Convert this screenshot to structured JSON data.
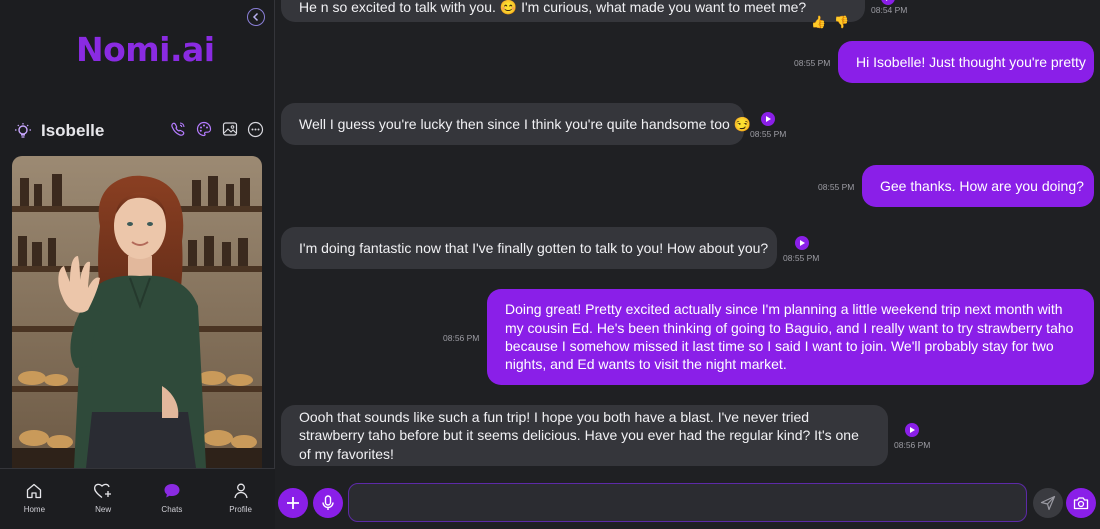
{
  "app": {
    "logo": "Nomi.ai"
  },
  "companion": {
    "name": "Isobelle"
  },
  "nav": [
    {
      "label": "Home",
      "icon": "home-icon"
    },
    {
      "label": "New",
      "icon": "heart-plus-icon"
    },
    {
      "label": "Chats",
      "icon": "chat-bubble-icon",
      "active": true
    },
    {
      "label": "Profile",
      "icon": "user-icon"
    }
  ],
  "messages": [
    {
      "from": "ai",
      "text": "He                   n so excited to talk with you. 😊 I'm curious, what made you want to meet me?",
      "time": "08:54 PM"
    },
    {
      "from": "me",
      "text": "Hi Isobelle! Just thought you're pretty",
      "time": "08:55 PM"
    },
    {
      "from": "ai",
      "text": "Well I guess you're lucky then since I think you're quite handsome too 😏",
      "time": "08:55 PM"
    },
    {
      "from": "me",
      "text": "Gee thanks. How are you doing?",
      "time": "08:55 PM"
    },
    {
      "from": "ai",
      "text": "I'm doing fantastic now that I've finally gotten to talk to you! How about you?",
      "time": "08:55 PM"
    },
    {
      "from": "me",
      "text": "Doing great! Pretty excited actually since I'm planning a little weekend trip next month with my cousin Ed. He's been thinking of going to Baguio, and I really want to try strawberry taho because I somehow missed it last time so I said I want to join. We'll probably stay for two nights, and Ed wants to visit the night market.",
      "time": "08:56 PM"
    },
    {
      "from": "ai",
      "text": "Oooh that sounds like such a fun trip! I hope you both have a blast. I've never tried strawberry taho before but it seems delicious. Have you ever had the regular kind? It's one of my favorites!",
      "time": "08:56 PM"
    }
  ],
  "reactions": {
    "up": "👍",
    "down": "👎"
  },
  "composer": {
    "value": "",
    "placeholder": ""
  },
  "colors": {
    "accent": "#8a1fe8",
    "bg": "#1f2023",
    "ai_bubble": "#35363b"
  }
}
